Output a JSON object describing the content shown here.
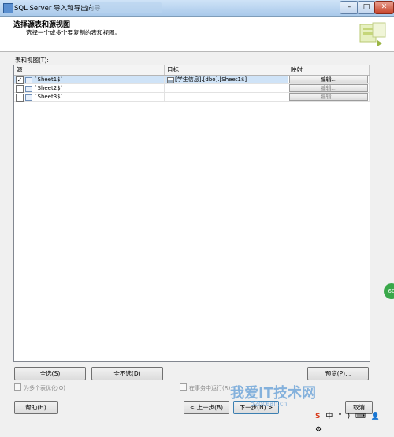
{
  "window": {
    "title": "SQL Server 导入和导出向导"
  },
  "header": {
    "title": "选择源表和源视图",
    "subtitle": "选择一个或多个要复制的表和视图。"
  },
  "tables_label": "表和视图(T):",
  "grid": {
    "columns": [
      "源",
      "目标",
      "映射"
    ],
    "rows": [
      {
        "checked": true,
        "source": "`Sheet1$`",
        "destination": "[学生信息].[dbo].[Sheet1$]",
        "mapping": "编辑...",
        "selected": true,
        "edit_enabled": true
      },
      {
        "checked": false,
        "source": "`Sheet2$`",
        "destination": "",
        "mapping": "编辑...",
        "selected": false,
        "edit_enabled": false
      },
      {
        "checked": false,
        "source": "`Sheet3$`",
        "destination": "",
        "mapping": "编辑...",
        "selected": false,
        "edit_enabled": false
      }
    ]
  },
  "buttons": {
    "select_all": "全选(S)",
    "deselect_all": "全不选(D)",
    "preview": "预览(P)...",
    "help": "帮助(H)",
    "back": "< 上一步(B)",
    "next": "下一步(N) >",
    "cancel": "取消"
  },
  "options": {
    "optimize_multi": "为多个表优化(O)",
    "run_in_transaction": "在事务中运行(R)"
  },
  "overlay": {
    "watermark": "我爱IT技术网",
    "watermark_sub": "52ocean.cn",
    "side_badge": "60"
  },
  "tray": {
    "items": [
      "S",
      "中",
      "°",
      ")",
      "⌨",
      "👤",
      "⚙"
    ]
  }
}
